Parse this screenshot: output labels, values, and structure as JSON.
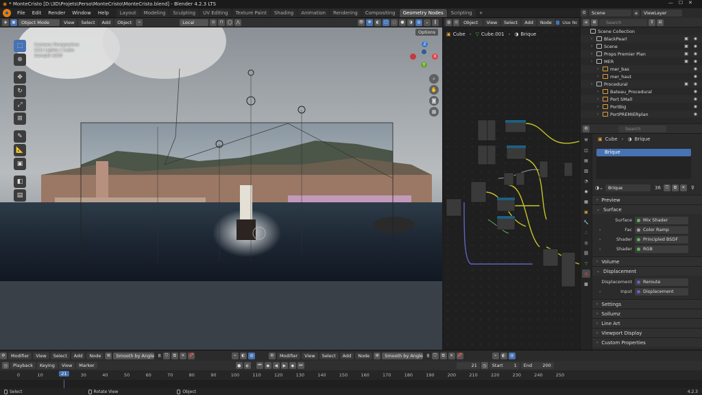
{
  "window": {
    "title": "* MonteCristo [D:\\3D\\Projets\\Perso\\MonteCristo\\MonteCristo.blend] - Blender 4.2.3 LTS",
    "controls": [
      "—",
      "☐",
      "✕"
    ]
  },
  "menubar": {
    "items": [
      "File",
      "Edit",
      "Render",
      "Window",
      "Help"
    ],
    "workspaces": [
      "Layout",
      "Modeling",
      "Sculpting",
      "UV Editing",
      "Texture Paint",
      "Shading",
      "Animation",
      "Rendering",
      "Compositing",
      "Geometry Nodes",
      "Scripting"
    ],
    "active_workspace": "Geometry Nodes",
    "add_tab": "+",
    "scene": "Scene",
    "view_layer": "ViewLayer"
  },
  "viewport": {
    "mode": "Object Mode",
    "menus": [
      "View",
      "Select",
      "Add",
      "Object"
    ],
    "transform": "Local",
    "options": "Options",
    "info_line1": "Camera Perspective",
    "info_line2": "(21) Lights | Cube",
    "info_line3": "Sample 6/50",
    "tools": [
      "select-box",
      "cursor",
      "move",
      "rotate",
      "scale",
      "transform",
      "annotate",
      "measure",
      "add-cube",
      "camera",
      "light"
    ],
    "gizmo": {
      "x": "X",
      "y": "Y",
      "z": "Z"
    }
  },
  "node_editor": {
    "object_label": "Object",
    "menus": [
      "View",
      "Select",
      "Add",
      "Node"
    ],
    "use_nodes": "Use Nodes",
    "breadcrumb": [
      "Cube",
      "Cube.001",
      "Brique"
    ]
  },
  "outliner": {
    "search_placeholder": "Search",
    "rows": [
      {
        "label": "Scene Collection",
        "indent": 0
      },
      {
        "label": "BlackPearl",
        "indent": 1
      },
      {
        "label": "Scene",
        "indent": 1
      },
      {
        "label": "Props Premier Plan",
        "indent": 1
      },
      {
        "label": "MER",
        "indent": 1
      },
      {
        "label": "mer_bas",
        "indent": 2
      },
      {
        "label": "mer_haut",
        "indent": 2
      },
      {
        "label": "Procedural",
        "indent": 1
      },
      {
        "label": "Bateau_Procedural",
        "indent": 2
      },
      {
        "label": "Port SMall",
        "indent": 2
      },
      {
        "label": "PortBig",
        "indent": 2
      },
      {
        "label": "PortPREMIERplan",
        "indent": 2
      }
    ]
  },
  "properties": {
    "search_placeholder": "Search",
    "breadcrumb": [
      "Cube",
      "Brique"
    ],
    "material_slot": "Brique",
    "material_name": "Brique",
    "user_count": "36",
    "sections": {
      "preview": "Preview",
      "surface": "Surface",
      "volume": "Volume",
      "displacement": "Displacement",
      "settings": "Settings",
      "sollumz": "Sollumz",
      "line_art": "Line Art",
      "viewport_display": "Viewport Display",
      "custom_properties": "Custom Properties"
    },
    "surface_rows": [
      {
        "label": "Surface",
        "value": "Mix Shader",
        "color": "#5cb85c"
      },
      {
        "label": "Fac",
        "value": "Color Ramp",
        "color": "#a0a0a0"
      },
      {
        "label": "Shader",
        "value": "Principled BSDF",
        "color": "#5cb85c"
      },
      {
        "label": "Shader",
        "value": "RGB",
        "color": "#5cb85c"
      }
    ],
    "displacement_rows": [
      {
        "label": "Displacement",
        "value": "Reroute",
        "color": "#6363c7"
      },
      {
        "label": "Input",
        "value": "Displacement",
        "color": "#6363c7"
      }
    ]
  },
  "bottom": {
    "left_modifier": "Modifier",
    "left_menus": [
      "View",
      "Select",
      "Add",
      "Node"
    ],
    "left_node": "Smooth by Angle",
    "left_count": "8",
    "right_modifier": "Modifier",
    "right_menus": [
      "View",
      "Select",
      "Add",
      "Node"
    ],
    "right_node": "Smooth by Angle",
    "right_count": "8"
  },
  "timeline": {
    "menus": [
      "Playback",
      "Keying",
      "View",
      "Marker"
    ],
    "current_frame": "21",
    "start_label": "Start",
    "start": "1",
    "end_label": "End",
    "end": "200",
    "ticks": [
      "0",
      "10",
      "21",
      "30",
      "40",
      "50",
      "60",
      "70",
      "80",
      "90",
      "100",
      "110",
      "120",
      "130",
      "140",
      "150",
      "160",
      "170",
      "180",
      "190",
      "200",
      "210",
      "220",
      "230",
      "240",
      "250"
    ]
  },
  "statusbar": {
    "select": "Select",
    "rotate_view": "Rotate View",
    "object": "Object",
    "version": "4.2.3"
  },
  "colors": {
    "accent": "#4772b3",
    "brand": "#e87d0d",
    "noodle_yellow": "#c7c729",
    "noodle_purple": "#6363c7",
    "noodle_green": "#5cb85c"
  }
}
